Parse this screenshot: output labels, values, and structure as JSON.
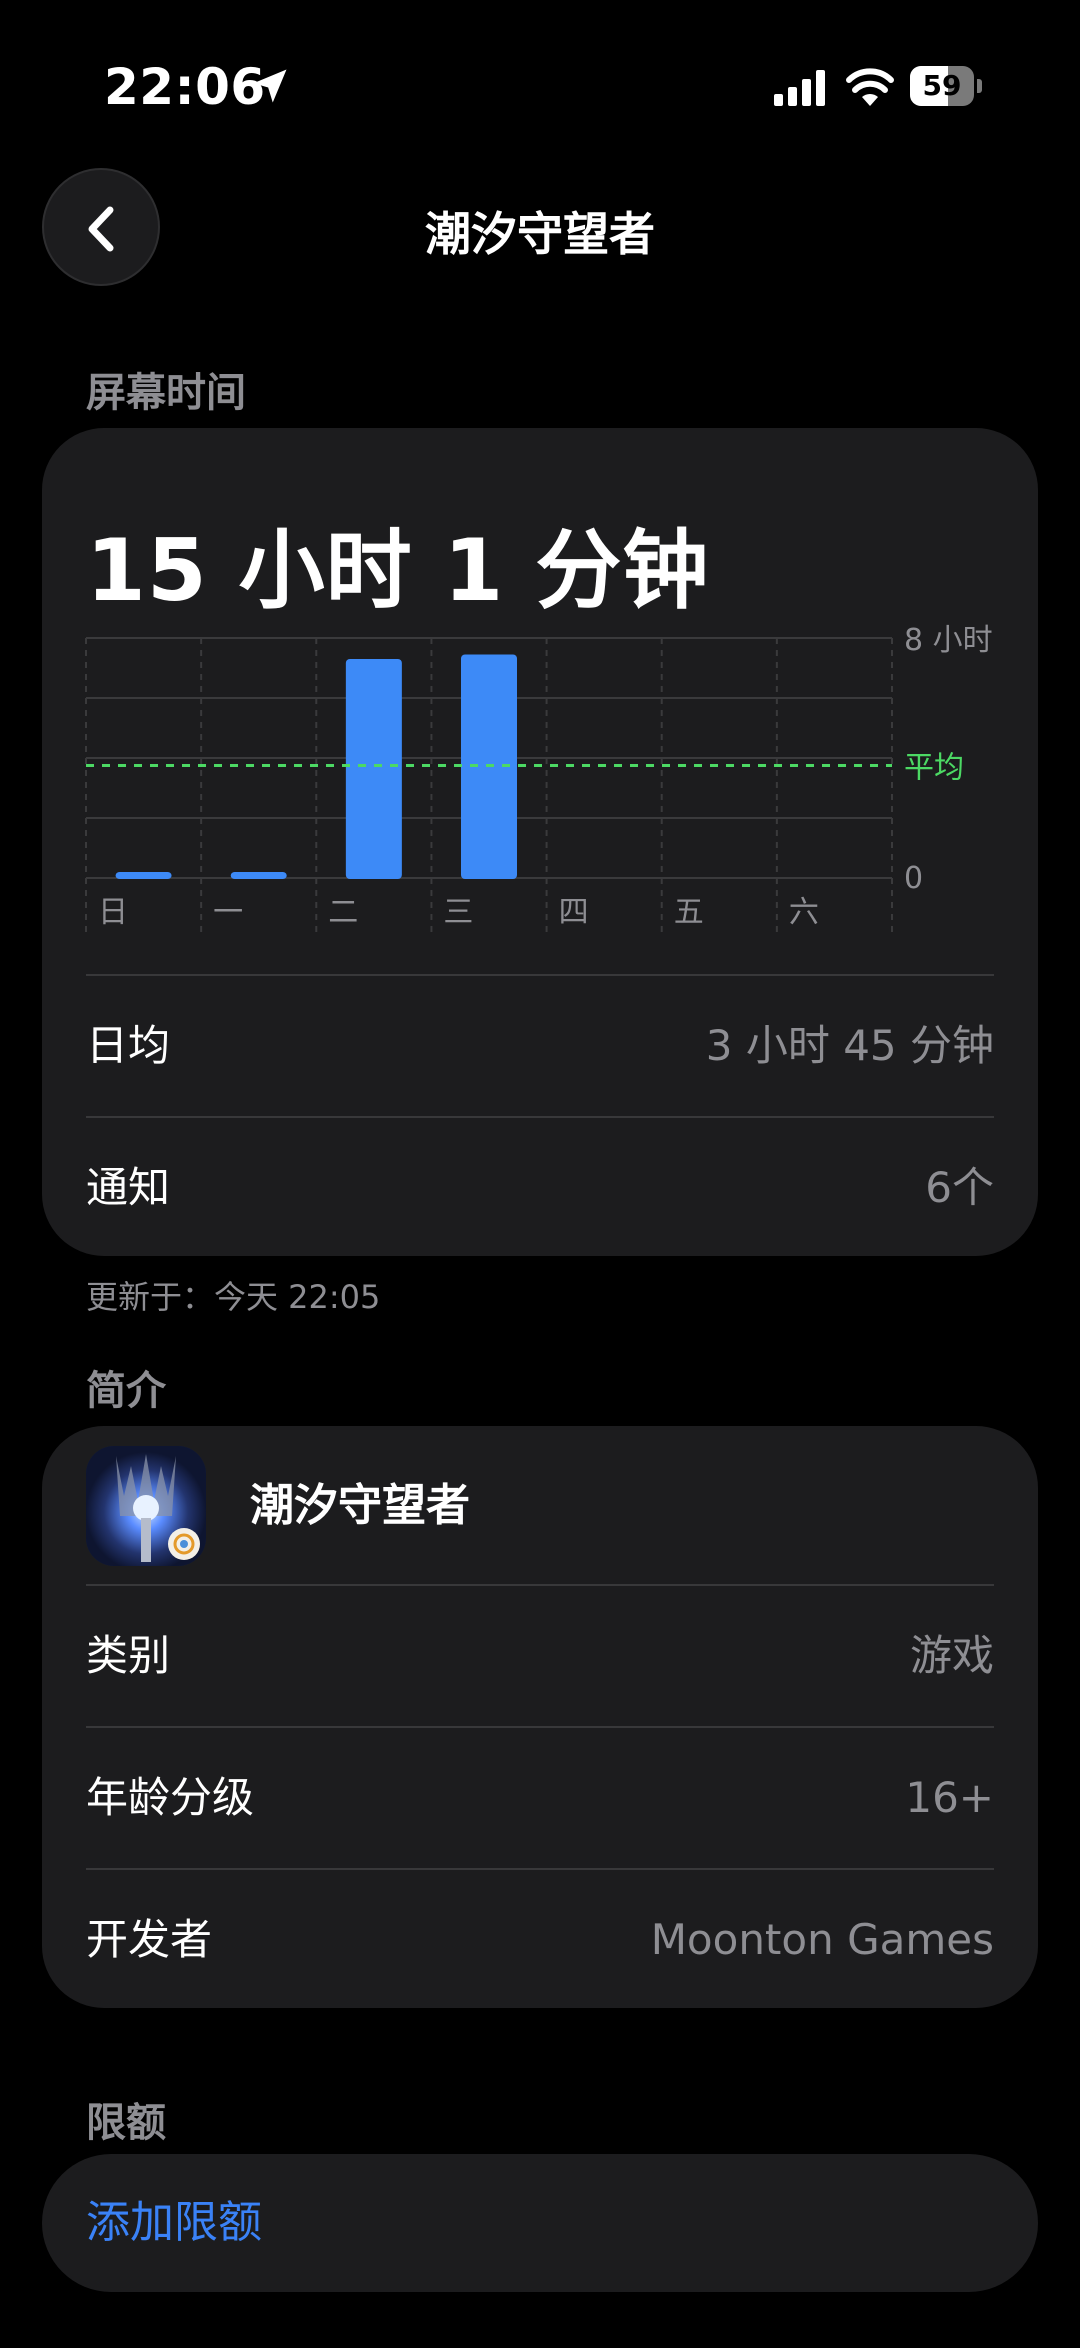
{
  "status_bar": {
    "time": "22:06",
    "battery": "59",
    "battery_level": 0.59
  },
  "nav": {
    "title": "潮汐守望者"
  },
  "screen_time": {
    "section_title": "屏幕时间",
    "total": "15 小时 1 分钟",
    "chart_data": {
      "type": "bar",
      "categories": [
        "日",
        "一",
        "二",
        "三",
        "四",
        "五",
        "六"
      ],
      "values": [
        0.12,
        0.1,
        7.3,
        7.45,
        0,
        0,
        0
      ],
      "unit": "小时",
      "ylim": [
        0,
        8
      ],
      "y_max_label": "8 小时",
      "y_min_label": "0",
      "average": 3.75,
      "average_label": "平均",
      "bar_color": "#3d8af7",
      "average_color": "#4cd964"
    },
    "daily_avg_label": "日均",
    "daily_avg_value": "3 小时 45 分钟",
    "notifications_label": "通知",
    "notifications_value": "6个",
    "updated": "更新于：今天 22:05"
  },
  "about": {
    "section_title": "简介",
    "app_name": "潮汐守望者",
    "category_label": "类别",
    "category_value": "游戏",
    "age_label": "年龄分级",
    "age_value": "16+",
    "developer_label": "开发者",
    "developer_value": "Moonton Games"
  },
  "limits": {
    "section_title": "限额",
    "add_label": "添加限额",
    "accent": "#3a82f7"
  }
}
